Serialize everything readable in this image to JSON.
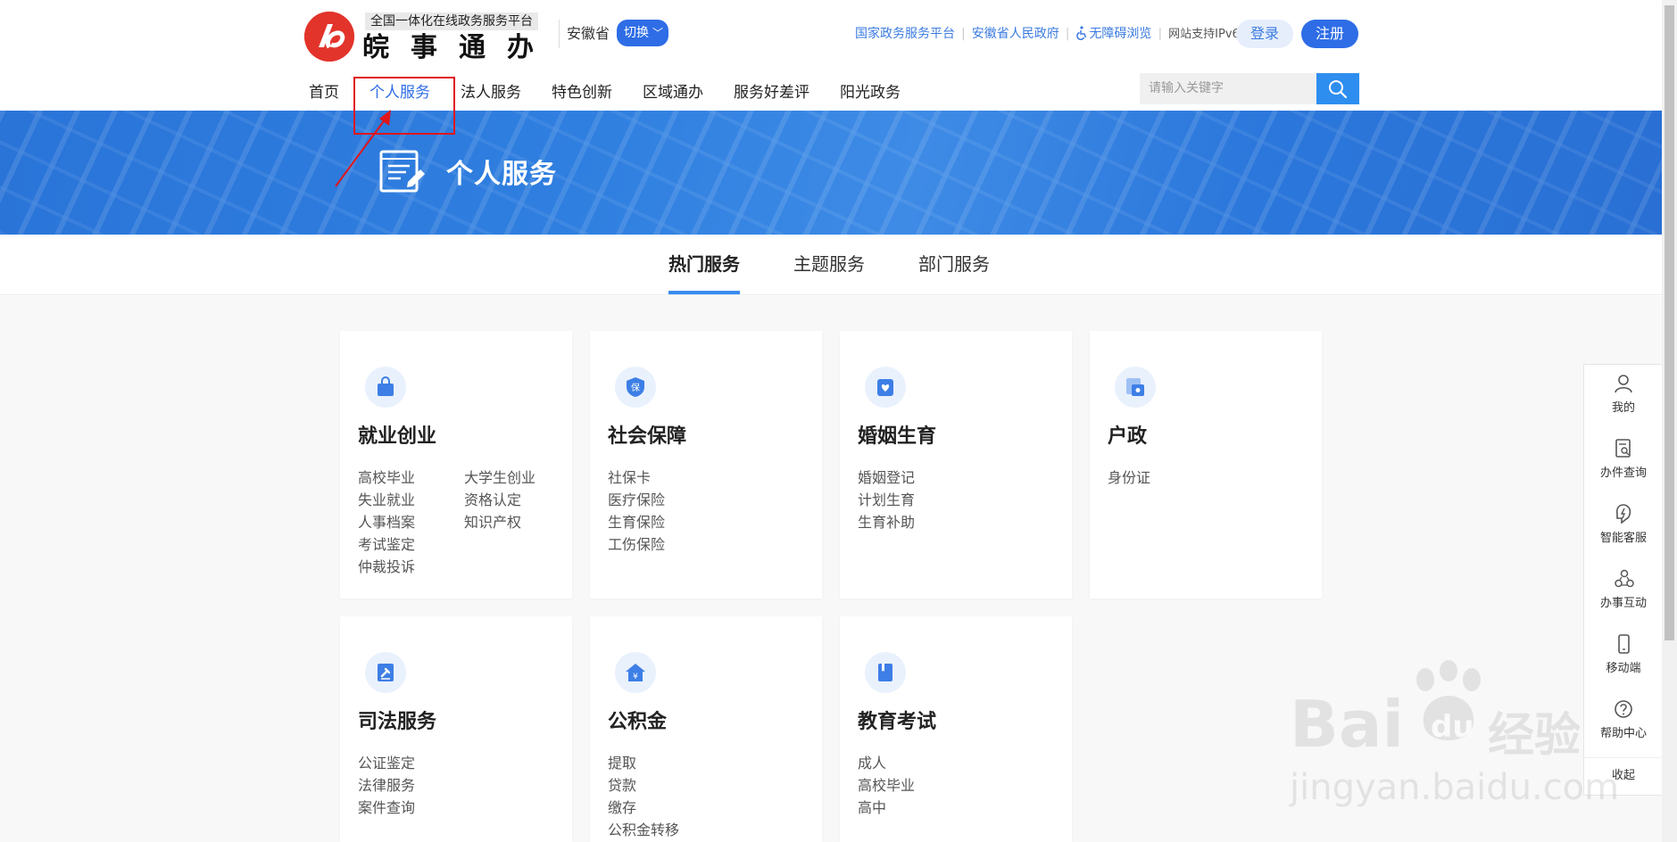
{
  "header": {
    "logo_sub": "全国一体化在线政务服务平台",
    "logo_title": "皖事通办",
    "province": "安徽省",
    "switch_label": "切换",
    "links": [
      "国家政务服务平台",
      "安徽省人民政府",
      "无障碍浏览"
    ],
    "ipv6_label": "网站支持IPv6",
    "login_label": "登录",
    "register_label": "注册",
    "search_placeholder": "请输入关键字"
  },
  "nav": {
    "items": [
      "首页",
      "个人服务",
      "法人服务",
      "特色创新",
      "区域通办",
      "服务好差评",
      "阳光政务"
    ],
    "active_index": 1
  },
  "banner": {
    "title": "个人服务"
  },
  "tabs": {
    "items": [
      "热门服务",
      "主题服务",
      "部门服务"
    ],
    "active_index": 0
  },
  "cards": [
    {
      "title": "就业创业",
      "icon": "bag-icon",
      "links": [
        "高校毕业",
        "大学生创业",
        "失业就业",
        "资格认定",
        "人事档案",
        "知识产权",
        "考试鉴定",
        "",
        "仲裁投诉",
        ""
      ]
    },
    {
      "title": "社会保障",
      "icon": "shield-icon",
      "icon_text": "保",
      "links": [
        "社保卡",
        "医疗保险",
        "生育保险",
        "工伤保险"
      ]
    },
    {
      "title": "婚姻生育",
      "icon": "heart-icon",
      "links": [
        "婚姻登记",
        "计划生育",
        "生育补助"
      ]
    },
    {
      "title": "户政",
      "icon": "id-card-icon",
      "links": [
        "身份证"
      ]
    },
    {
      "title": "司法服务",
      "icon": "gavel-icon",
      "links": [
        "公证鉴定",
        "法律服务",
        "案件查询"
      ]
    },
    {
      "title": "公积金",
      "icon": "house-yen-icon",
      "icon_text": "¥",
      "links": [
        "提取",
        "贷款",
        "缴存",
        "公积金转移"
      ]
    },
    {
      "title": "教育考试",
      "icon": "book-icon",
      "links": [
        "成人",
        "高校毕业",
        "高中"
      ]
    }
  ],
  "sidewidget": {
    "items": [
      "我的",
      "办件查询",
      "智能客服",
      "办事互动",
      "移动端",
      "帮助中心"
    ],
    "collapse_label": "收起"
  },
  "watermark": {
    "line1": "Bai",
    "du": "du",
    "jingyan": "经验",
    "line2": "jingyan.baidu.com"
  },
  "colors": {
    "brand_red": "#e2342b",
    "primary_blue": "#2e6de6",
    "link_blue": "#3b7be0",
    "annotation_red": "#e0161b"
  }
}
